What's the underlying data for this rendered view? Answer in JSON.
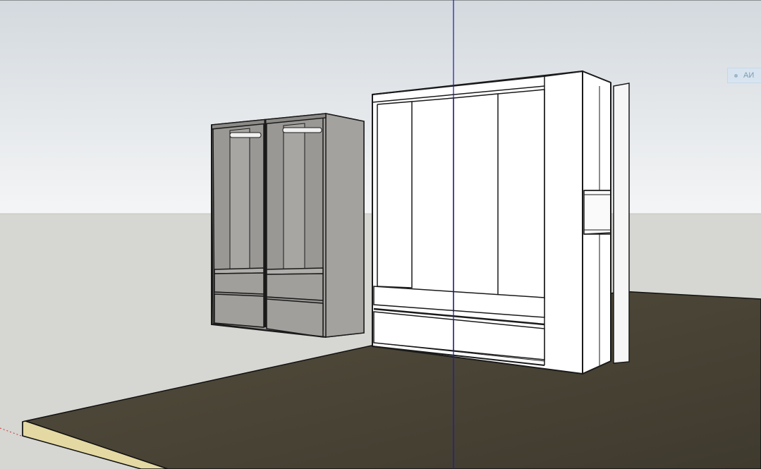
{
  "viewport": {
    "colors": {
      "sky_top": "#d5dbe0",
      "sky_bottom": "#f3f4f6",
      "ground": "#d6d6d2",
      "floor": "#4a4537",
      "floor_edge": "#e6dca6",
      "wardrobe_gray": "#9d9b98",
      "wardrobe_white": "#ffffff",
      "axis_blue": "#1a1aa8",
      "axis_red": "#cc3333",
      "edge": "#1a1a1a"
    }
  },
  "scene_tag": {
    "label": "АИ",
    "icon": "scene-dot-icon"
  }
}
